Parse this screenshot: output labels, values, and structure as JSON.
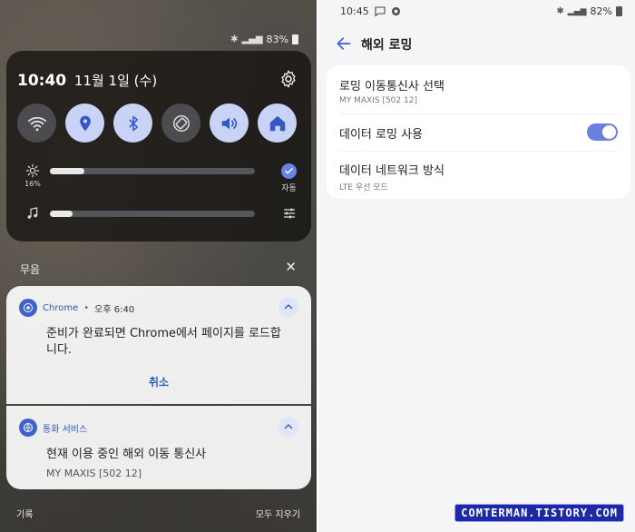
{
  "left": {
    "status_battery": "83%",
    "quick_panel": {
      "time": "10:40",
      "date": "11월 1일 (수)",
      "brightness_level_label": "16%",
      "brightness_fraction": 0.17,
      "media_fraction": 0.11,
      "auto_label": "자동",
      "tiles": [
        {
          "name": "wifi",
          "on": false
        },
        {
          "name": "location",
          "on": true
        },
        {
          "name": "bluetooth",
          "on": true
        },
        {
          "name": "auto-rotate",
          "on": false
        },
        {
          "name": "sound",
          "on": true
        },
        {
          "name": "home",
          "on": true
        }
      ]
    },
    "muted_label": "무음",
    "notifications": [
      {
        "app": "Chrome",
        "time": "오후 6:40",
        "body": "준비가 완료되면 Chrome에서 페이지를 로드합니다.",
        "action": "취소"
      },
      {
        "app": "통화 서비스",
        "body": "현재 이용 중인 해외 이동 통신사",
        "sub": "MY MAXIS [502 12]"
      }
    ],
    "history_label": "기록",
    "clear_all_label": "모두 지우기"
  },
  "right": {
    "status_time": "10:45",
    "status_battery": "82%",
    "title": "해외 로밍",
    "settings": [
      {
        "title": "로밍 이동통신사 선택",
        "sub": "MY MAXIS [502 12]"
      },
      {
        "title": "데이터 로밍 사용",
        "toggle": true
      },
      {
        "title": "데이터 네트워크 방식",
        "sub": "LTE 우선 모드"
      }
    ],
    "accent_color": "#6a7fe0"
  },
  "watermark": "COMTERMAN.TISTORY.COM"
}
